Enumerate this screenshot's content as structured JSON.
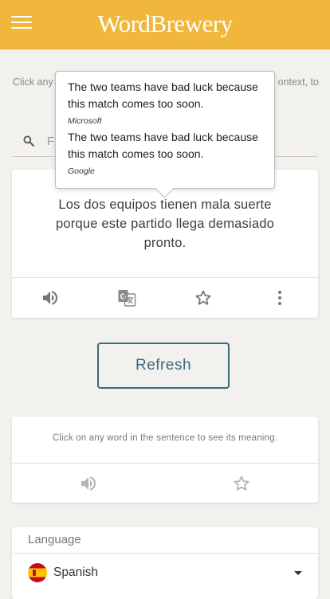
{
  "header": {
    "logo_text": "WordBrewery"
  },
  "instructions": {
    "left_fragment": "Click any",
    "right_fragment": "ontext, to"
  },
  "search": {
    "placeholder_fragment": "F"
  },
  "tooltip": {
    "translations": [
      {
        "text": "The two teams have bad luck because this match comes too soon.",
        "source": "Microsoft"
      },
      {
        "text": "The two teams have bad luck because this match comes too soon.",
        "source": "Google"
      }
    ]
  },
  "sentence_card": {
    "sentence": "Los dos equipos tienen mala suerte porque este partido llega demasiado pronto.",
    "actions": [
      "speaker-icon",
      "translate-icon",
      "star-icon",
      "more-vert-icon"
    ]
  },
  "refresh_label": "Refresh",
  "word_card": {
    "message": "Click on any word in the sentence to see its meaning.",
    "actions": [
      "speaker-icon",
      "star-icon"
    ]
  },
  "language_card": {
    "label": "Language",
    "selected": "Spanish",
    "flag": "spain-flag-icon"
  },
  "colors": {
    "header": "#f0b73c",
    "accent": "#3d6a7e",
    "background": "#f3f1ee"
  }
}
